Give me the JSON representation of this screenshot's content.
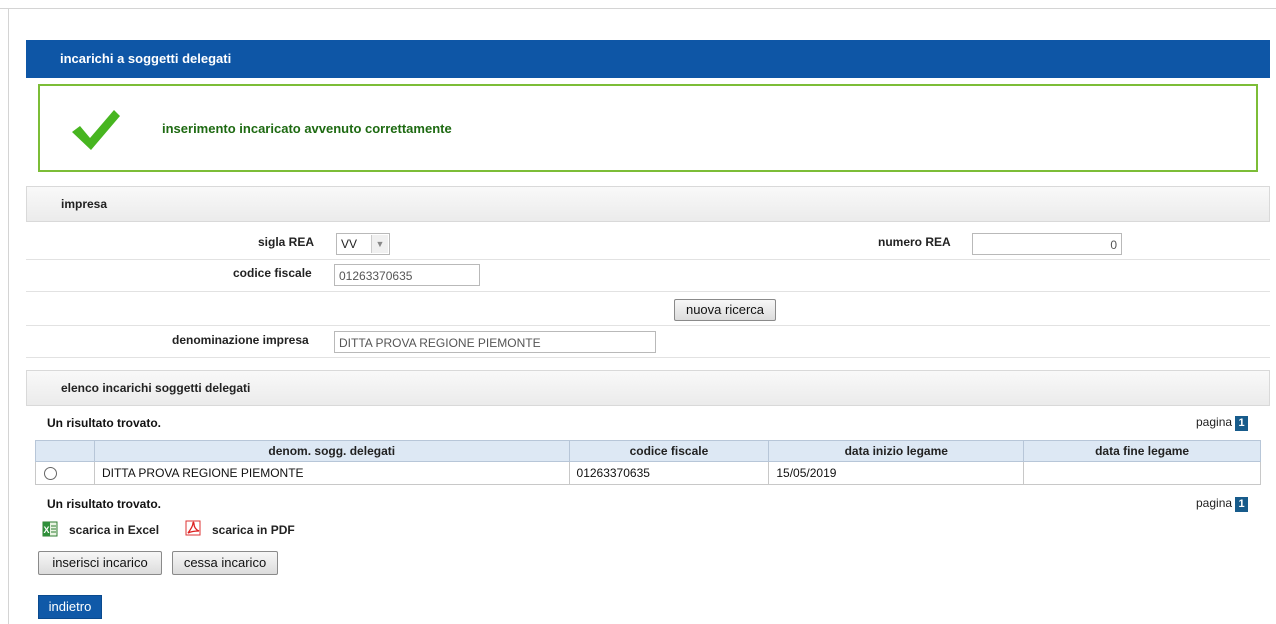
{
  "title": "incarichi a soggetti delegati",
  "success": {
    "message": "inserimento incaricato avvenuto correttamente",
    "icon": "checkmark-icon"
  },
  "impresa": {
    "section_title": "impresa",
    "sigla_rea_label": "sigla REA",
    "sigla_rea_value": "VV",
    "numero_rea_label": "numero REA",
    "numero_rea_value": "0",
    "codice_fiscale_label": "codice fiscale",
    "codice_fiscale_value": "01263370635",
    "nuova_ricerca": "nuova ricerca",
    "denominazione_label": "denominazione impresa",
    "denominazione_value": "DITTA PROVA REGIONE PIEMONTE"
  },
  "elenco": {
    "section_title": "elenco incarichi soggetti delegati",
    "result_text": "Un risultato trovato.",
    "pagina_label": "pagina",
    "page_number": "1",
    "columns": [
      "denom. sogg. delegati",
      "codice fiscale",
      "data inizio legame",
      "data fine legame"
    ],
    "rows": [
      {
        "denominazione": "DITTA PROVA REGIONE PIEMONTE",
        "codice_fiscale": "01263370635",
        "data_inizio": "15/05/2019",
        "data_fine": ""
      }
    ]
  },
  "downloads": {
    "excel": "scarica in Excel",
    "pdf": "scarica in PDF"
  },
  "actions": {
    "inserisci": "inserisci incarico",
    "cessa": "cessa incarico",
    "indietro": "indietro"
  },
  "colors": {
    "header_blue": "#0e56a6",
    "success_green": "#7cbd37",
    "success_text": "#1e6a12"
  }
}
